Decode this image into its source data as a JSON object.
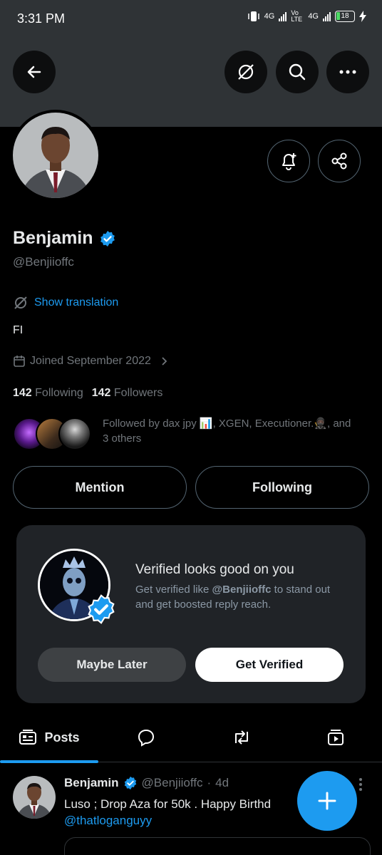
{
  "status": {
    "time": "3:31 PM",
    "net1": "4G",
    "volte": "Vo LTE",
    "net2": "4G",
    "battery": "18"
  },
  "profile": {
    "name": "Benjamin",
    "handle": "@Benjiioffc",
    "translation_label": "Show translation",
    "bio": "FI",
    "joined": "Joined September 2022",
    "following_count": "142",
    "following_label": "Following",
    "followers_count": "142",
    "followers_label": "Followers",
    "followed_by": "Followed by dax jpy 📊, XGEN, Executioner.🥷🏿, and 3 others",
    "verified_color": "#1d9bf0"
  },
  "actions": {
    "mention_label": "Mention",
    "following_label": "Following"
  },
  "verify_card": {
    "title": "Verified looks good on you",
    "desc_prefix": "Get verified like ",
    "desc_handle": "@Benjiioffc",
    "desc_suffix": " to stand out and get boosted reply reach.",
    "maybe_label": "Maybe Later",
    "get_label": "Get Verified"
  },
  "tabs": {
    "posts_label": "Posts",
    "active": "Posts"
  },
  "post": {
    "author": "Benjamin",
    "handle": "@Benjiioffc",
    "sep": "·",
    "time": "4d",
    "text": "Luso ; Drop Aza for 50k . Happy Birthd",
    "mention": "@thatloganguyy"
  },
  "icons": {
    "back": "arrow-left-icon",
    "translate": "translate-icon",
    "search": "search-icon",
    "more": "more-icon",
    "notify": "bell-plus-icon",
    "share": "share-icon",
    "calendar": "calendar-icon",
    "fab": "plus-icon"
  },
  "colors": {
    "accent": "#1d9bf0",
    "background": "#000000",
    "banner": "#2f3336",
    "card": "#202327",
    "muted": "#71767b"
  }
}
